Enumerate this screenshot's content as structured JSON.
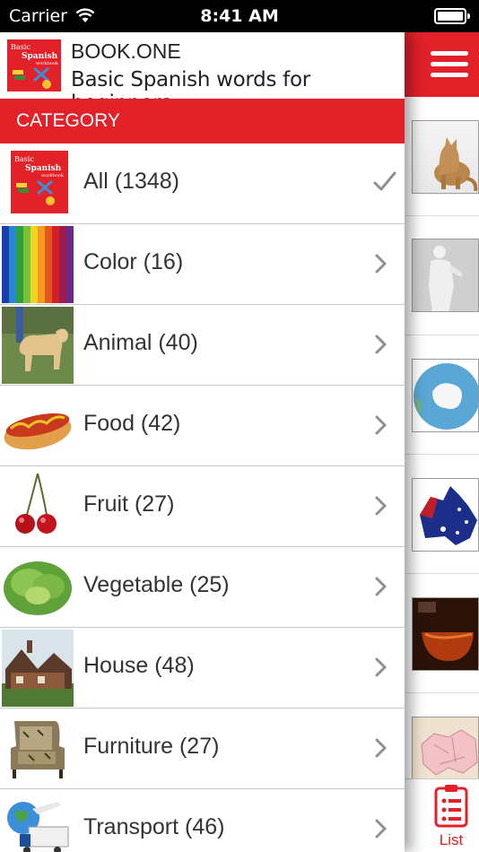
{
  "status_bar": {
    "carrier": "Carrier",
    "time": "8:41 AM"
  },
  "app": {
    "title": "BOOK.ONE",
    "subtitle": "Basic Spanish words for beginners",
    "logo_text": {
      "line1": "Basic",
      "line2": "Spanish",
      "line3": "workbook"
    }
  },
  "category_header": "CATEGORY",
  "categories": [
    {
      "label": "All (1348)",
      "image": "book-cover",
      "selected": true
    },
    {
      "label": "Color (16)",
      "image": "colored-pencils",
      "selected": false
    },
    {
      "label": "Animal (40)",
      "image": "dog",
      "selected": false
    },
    {
      "label": "Food (42)",
      "image": "hot-dog",
      "selected": false
    },
    {
      "label": "Fruit (27)",
      "image": "cherries",
      "selected": false
    },
    {
      "label": "Vegetable (25)",
      "image": "lettuce",
      "selected": false
    },
    {
      "label": "House (48)",
      "image": "house",
      "selected": false
    },
    {
      "label": "Furniture (27)",
      "image": "armchair",
      "selected": false
    },
    {
      "label": "Transport (46)",
      "image": "transport",
      "selected": false
    }
  ],
  "background_list": {
    "thumbnails": [
      "cat",
      "statue",
      "antarctica-globe",
      "australia-flag-map",
      "brandy-glass",
      "europe-map"
    ]
  },
  "tab_bar": {
    "list_label": "List"
  },
  "colors": {
    "accent": "#e32128",
    "status_bar": "#000000",
    "chevron": "#8e8e93"
  }
}
